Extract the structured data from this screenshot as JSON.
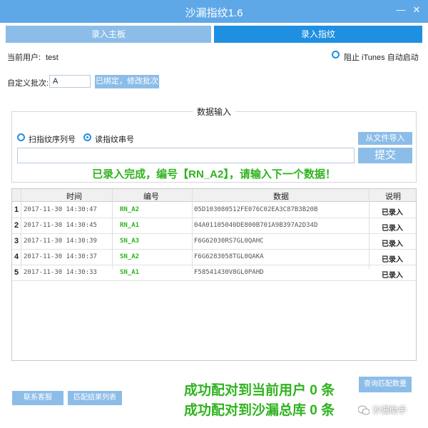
{
  "window": {
    "title": "沙漏指纹1.6",
    "minimize_glyph": "—",
    "close_glyph": "✕"
  },
  "tabs": [
    {
      "label": "录入主板",
      "active": false
    },
    {
      "label": "录入指纹",
      "active": true
    }
  ],
  "user": {
    "label": "当前用户:",
    "value": "test"
  },
  "itunes_option": {
    "label": "阻止 iTunes 自动启动",
    "checked": false
  },
  "batch": {
    "label": "自定义批次:",
    "value": "A",
    "button_label": "已绑定，修改批次"
  },
  "data_input": {
    "group_title": "数据输入",
    "mode_scan_label": "扫指纹序列号",
    "mode_read_label": "读指纹串号",
    "mode_scan_checked": false,
    "mode_read_checked": true,
    "import_button_label": "从文件导入",
    "entry_value": "",
    "submit_button_label": "提交",
    "status_message": "已录入完成，编号【RN_A2】，请输入下一个数据！"
  },
  "table": {
    "headers": [
      "时间",
      "编号",
      "数据",
      "说明"
    ],
    "rows": [
      {
        "n": "1",
        "time": "2017-11-30 14:30:47",
        "code": "RN_A2",
        "data": "05D103080512FE076C02EA3C87B3B20B",
        "note": "已录入"
      },
      {
        "n": "2",
        "time": "2017-11-30 14:30:45",
        "code": "RN_A1",
        "data": "04A01105040DE800B701A9B397A2D34D",
        "note": "已录入"
      },
      {
        "n": "3",
        "time": "2017-11-30 14:30:39",
        "code": "SN_A3",
        "data": "F6G62030RS7GL0QAHC",
        "note": "已录入"
      },
      {
        "n": "4",
        "time": "2017-11-30 14:30:37",
        "code": "SN_A2",
        "data": "F6G6283058TGL0QAKA",
        "note": "已录入"
      },
      {
        "n": "5",
        "time": "2017-11-30 14:30:33",
        "code": "SN_A1",
        "data": "F58541430V8GL0PAHD",
        "note": "已录入"
      }
    ]
  },
  "footer": {
    "support_button_label": "联系客服",
    "match_list_button_label": "匹配结果列表",
    "match_user_text": "成功配对到当前用户 0 条",
    "match_db_text": "成功配对到沙漏总库 0 条",
    "query_button_label": "查询匹配数量",
    "watermark_text": "沙漏助手"
  },
  "colors": {
    "accent": "#1f8fe2",
    "accent_light": "#8cbde8",
    "titlebar": "#5ea8e8",
    "success": "#2fb31e"
  }
}
